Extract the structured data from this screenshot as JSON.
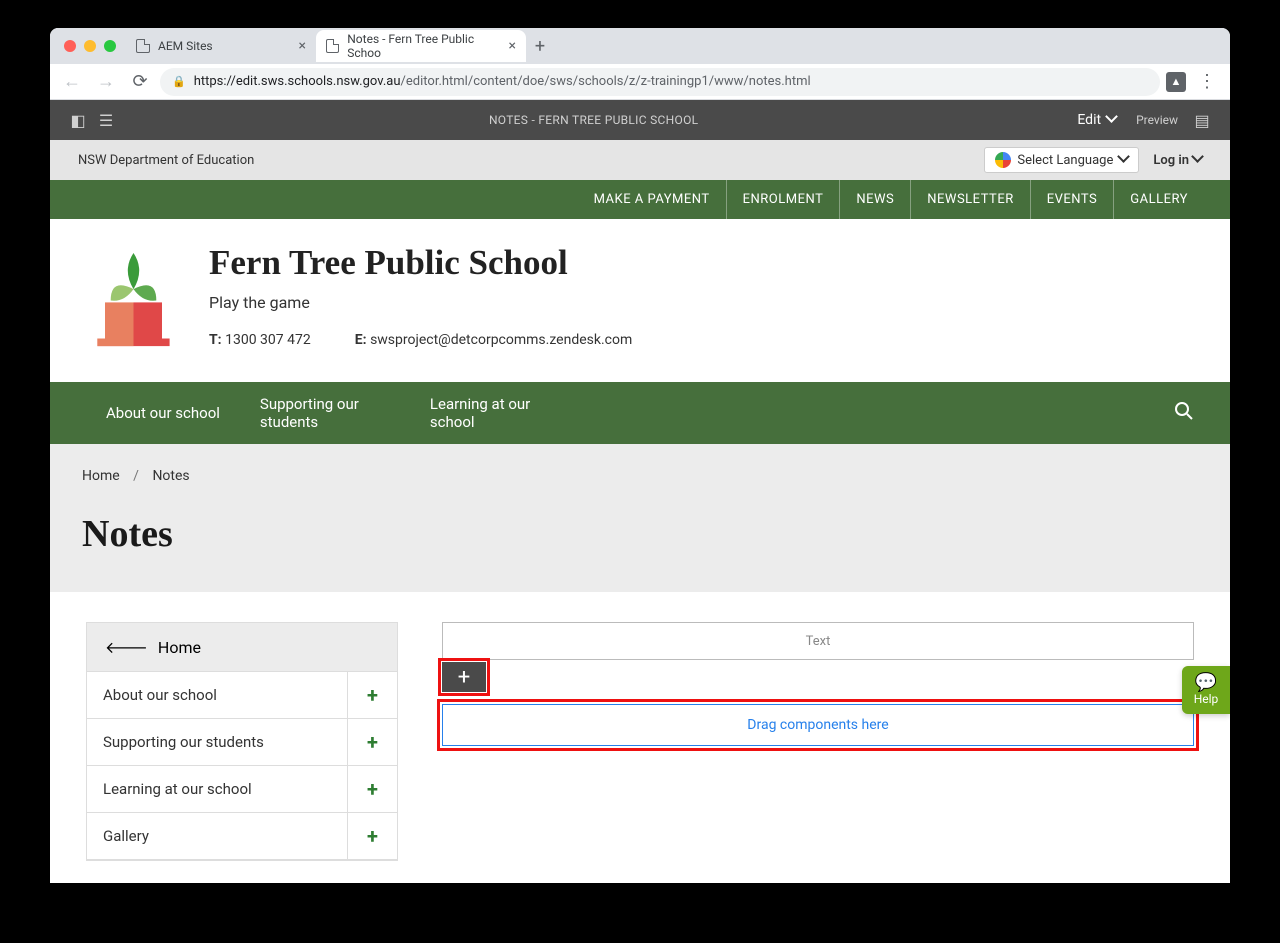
{
  "browser": {
    "tabs": [
      {
        "title": "AEM Sites",
        "active": false
      },
      {
        "title": "Notes - Fern Tree Public Schoo",
        "active": true
      }
    ],
    "url_dark": "https://edit.sws.schools.nsw.gov.au",
    "url_rest": "/editor.html/content/doe/sws/schools/z/z-trainingp1/www/notes.html"
  },
  "aem": {
    "title": "NOTES - FERN TREE PUBLIC SCHOOL",
    "edit": "Edit",
    "preview": "Preview"
  },
  "deptbar": {
    "dept": "NSW Department of Education",
    "lang": "Select Language",
    "login": "Log in"
  },
  "top_links": [
    "MAKE A PAYMENT",
    "ENROLMENT",
    "NEWS",
    "NEWSLETTER",
    "EVENTS",
    "GALLERY"
  ],
  "school": {
    "name": "Fern Tree Public School",
    "motto": "Play the game",
    "phone_label": "T:",
    "phone": "1300 307 472",
    "email_label": "E:",
    "email": "swsproject@detcorpcomms.zendesk.com"
  },
  "main_nav": [
    "About our school",
    "Supporting our students",
    "Learning at our school"
  ],
  "breadcrumb": {
    "home": "Home",
    "current": "Notes"
  },
  "page_title": "Notes",
  "sidenav": {
    "home": "Home",
    "items": [
      "About our school",
      "Supporting our students",
      "Learning at our school",
      "Gallery"
    ]
  },
  "editor": {
    "text_slot": "Text",
    "drop": "Drag components here"
  },
  "help": "Help"
}
